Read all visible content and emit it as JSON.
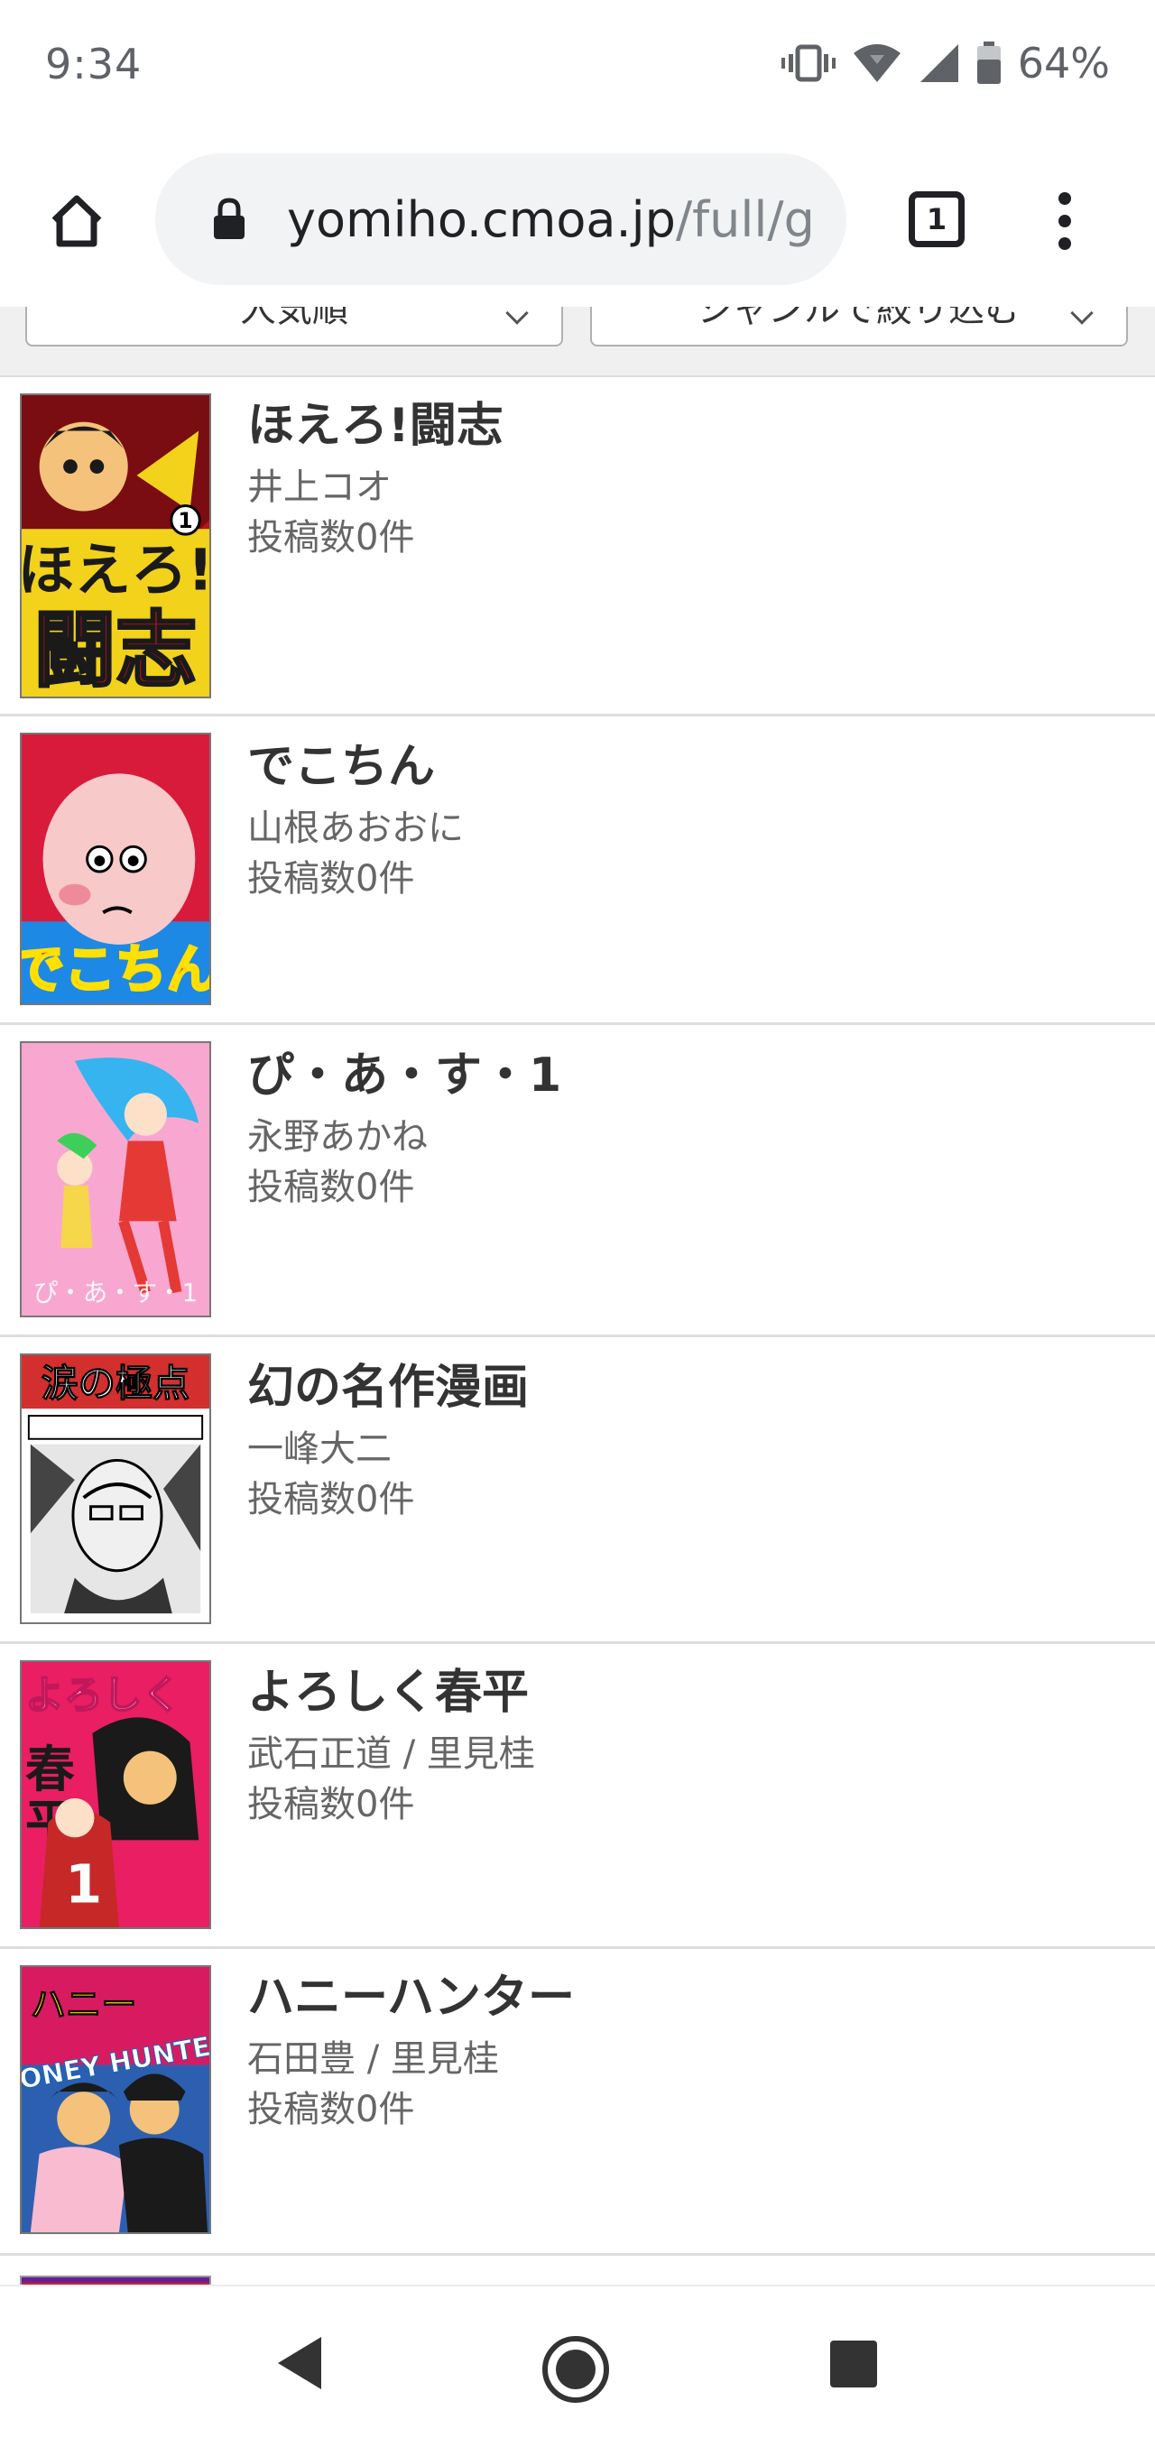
{
  "status_bar": {
    "time": "9:34",
    "battery": "64%",
    "icons": [
      "vibrate-icon",
      "wifi-icon",
      "cell-signal-icon",
      "battery-icon"
    ]
  },
  "browser": {
    "url_host": "yomiho.cmoa.jp",
    "url_path": "/full/ge",
    "tab_count": "1",
    "icons": [
      "home-icon",
      "lock-icon",
      "tab-switcher-icon",
      "overflow-menu-icon"
    ]
  },
  "filters": {
    "sort_label": "人気順",
    "genre_label": "ジャンルで絞り込む"
  },
  "books": [
    {
      "title": "ほえろ!闘志",
      "author": "井上コオ",
      "posts": "投稿数0件",
      "cover_text": "ほえろ!闘志",
      "cover_colors": [
        "#f2d21a",
        "#b8141b"
      ]
    },
    {
      "title": "でこちん",
      "author": "山根あおおに",
      "posts": "投稿数0件",
      "cover_text": "でこちん",
      "cover_colors": [
        "#1e88e5",
        "#e53935"
      ]
    },
    {
      "title": "ぴ・あ・す・1",
      "author": "永野あかね",
      "posts": "投稿数0件",
      "cover_text": "ぴ・あ・す・1",
      "cover_colors": [
        "#f8a8d0",
        "#e91e63"
      ]
    },
    {
      "title": "幻の名作漫画",
      "author": "一峰大二",
      "posts": "投稿数0件",
      "cover_text": "涙の極点",
      "cover_colors": [
        "#ffffff",
        "#d32f2f"
      ]
    },
    {
      "title": "よろしく春平",
      "author": "武石正道 / 里見桂",
      "posts": "投稿数0件",
      "cover_text": "よろしく春平",
      "cover_colors": [
        "#e91e63",
        "#1a1a1a"
      ]
    },
    {
      "title": "ハニーハンター",
      "author": "石田豊 / 里見桂",
      "posts": "投稿数0件",
      "cover_text": "HONEY HUNTER",
      "cover_colors": [
        "#d81b60",
        "#1565c0"
      ]
    }
  ],
  "nav_bar": {
    "icons": [
      "back-icon",
      "home-circle-icon",
      "recents-icon"
    ]
  }
}
